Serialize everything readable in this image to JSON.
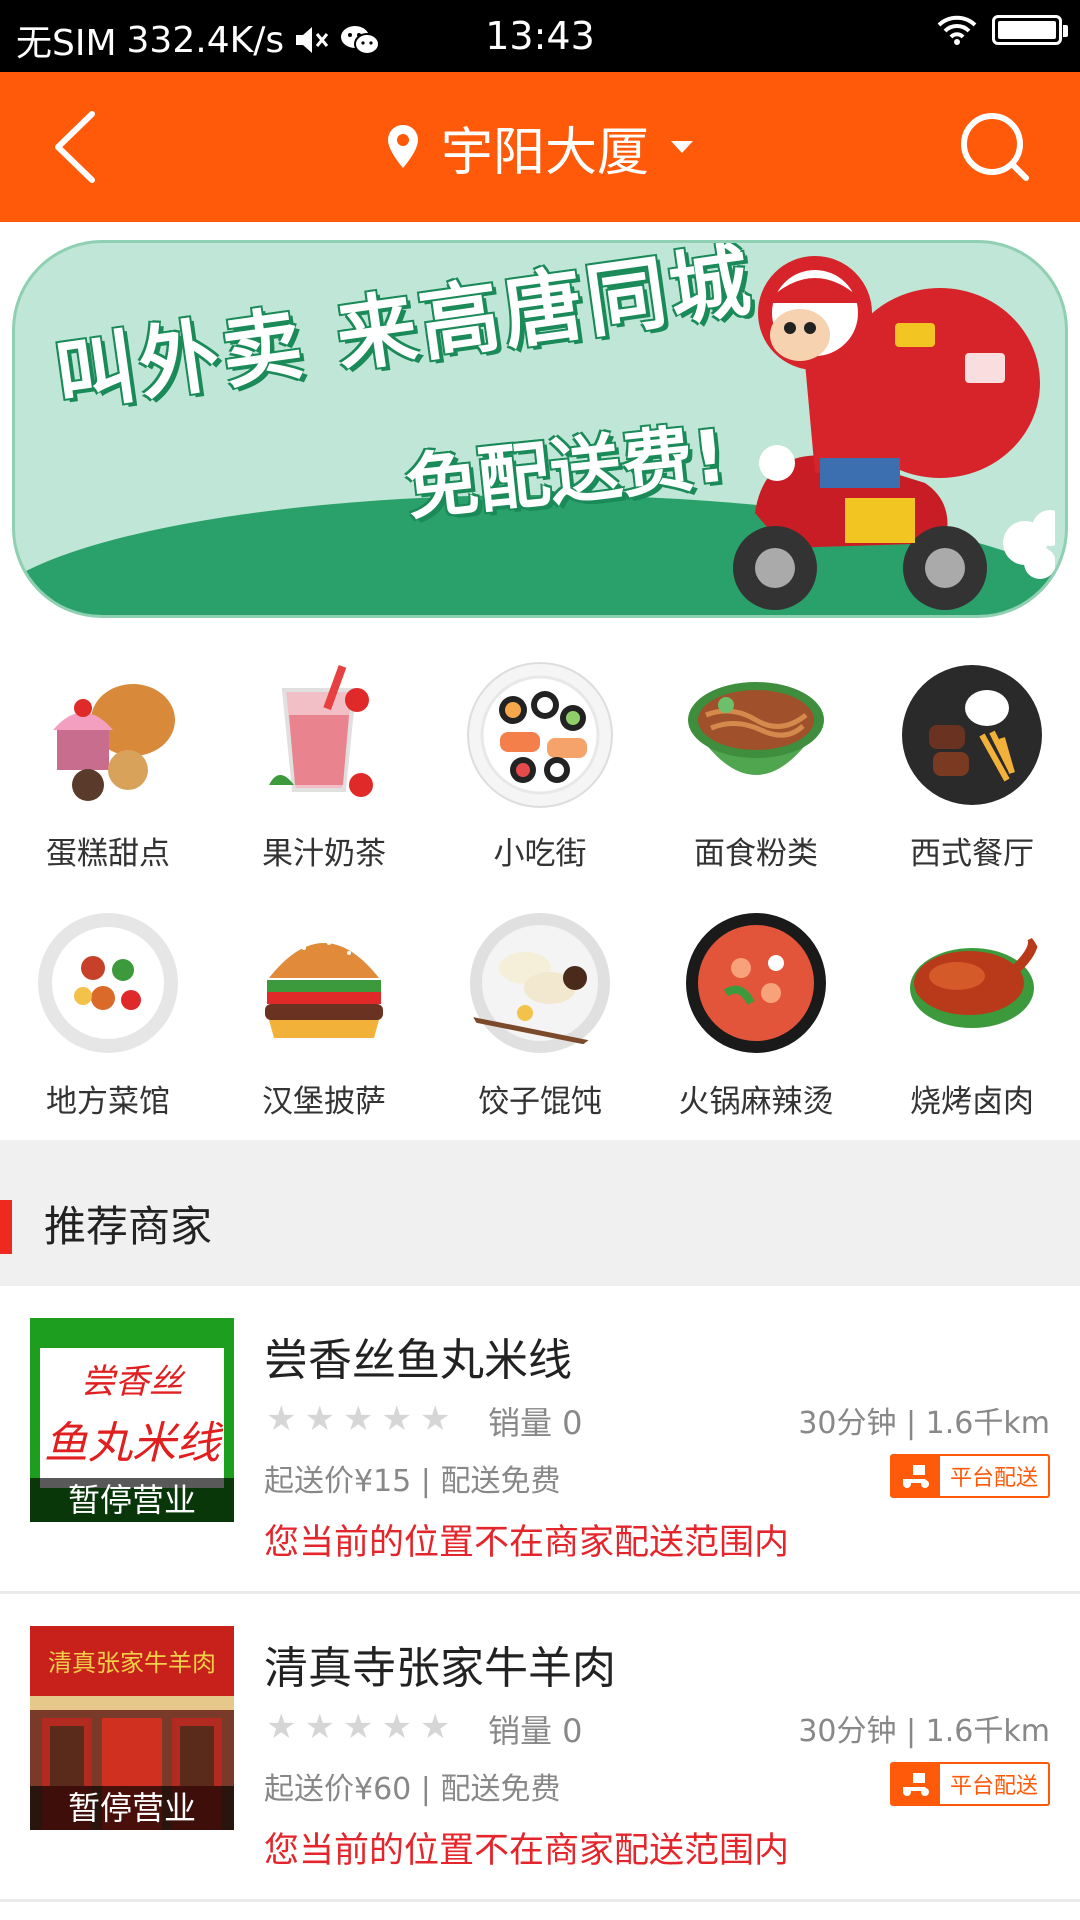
{
  "status_bar": {
    "carrier": "无SIM",
    "speed": "332.4K/s",
    "time": "13:43"
  },
  "header": {
    "location": "宇阳大厦"
  },
  "banner": {
    "line1": "叫外卖 来高唐同城",
    "line2": "免配送费!"
  },
  "categories": [
    {
      "label": "蛋糕甜点",
      "icon": "cake-icon"
    },
    {
      "label": "果汁奶茶",
      "icon": "juice-icon"
    },
    {
      "label": "小吃街",
      "icon": "sushi-icon"
    },
    {
      "label": "面食粉类",
      "icon": "noodles-icon"
    },
    {
      "label": "西式餐厅",
      "icon": "steak-icon"
    },
    {
      "label": "地方菜馆",
      "icon": "local-dish-icon"
    },
    {
      "label": "汉堡披萨",
      "icon": "burger-icon"
    },
    {
      "label": "饺子馄饨",
      "icon": "dumpling-icon"
    },
    {
      "label": "火锅麻辣烫",
      "icon": "hotpot-icon"
    },
    {
      "label": "烧烤卤肉",
      "icon": "roast-icon"
    }
  ],
  "section": {
    "title": "推荐商家"
  },
  "shops": [
    {
      "name": "尝香丝鱼丸米线",
      "sales": "销量 0",
      "distance": "30分钟 | 1.6千km",
      "price": "起送价¥15 | 配送免费",
      "badge": "平台配送",
      "status": "暂停营业",
      "warning": "您当前的位置不在商家配送范围内",
      "sign_text": "尝香丝 鱼丸米线"
    },
    {
      "name": "清真寺张家牛羊肉",
      "sales": "销量 0",
      "distance": "30分钟 | 1.6千km",
      "price": "起送价¥60 | 配送免费",
      "badge": "平台配送",
      "status": "暂停营业",
      "warning": "您当前的位置不在商家配送范围内",
      "sign_text": "清真张家牛羊肉"
    }
  ],
  "colors": {
    "accent": "#ff5a0a",
    "warning": "#e4262c",
    "section_bar": "#ee2a1e"
  }
}
